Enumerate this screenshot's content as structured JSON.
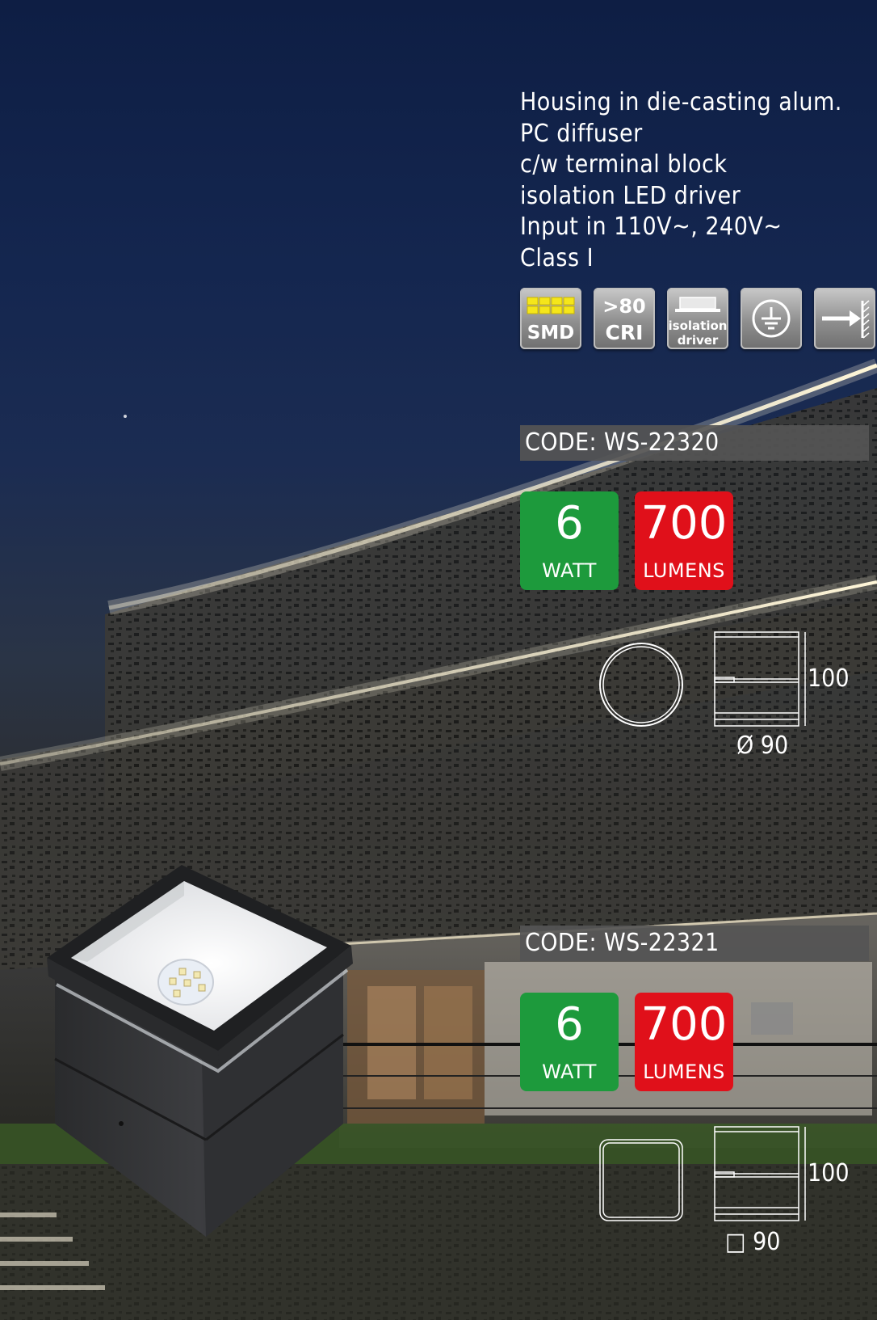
{
  "specs": {
    "lines": [
      "Housing in die-casting alum.",
      "PC diffuser",
      "c/w terminal block",
      "isolation LED driver",
      "Input in 110V~, 240V~",
      "Class I"
    ]
  },
  "badges": {
    "smd": "SMD",
    "cri_value": ">80",
    "cri_label": "CRI",
    "isolation_line1": "isolation",
    "isolation_line2": "driver",
    "class_icon": "earth-ground-icon",
    "distance_icon": "arrow-to-wall-icon"
  },
  "products": [
    {
      "code": "CODE: WS-22320",
      "watt_value": "6",
      "watt_label": "WATT",
      "lumen_value": "700",
      "lumen_label": "LUMENS",
      "height": "100",
      "width": "Ø 90",
      "shape": "round"
    },
    {
      "code": "CODE: WS-22321",
      "watt_value": "6",
      "watt_label": "WATT",
      "lumen_value": "700",
      "lumen_label": "LUMENS",
      "height": "100",
      "width": "□ 90",
      "shape": "square"
    }
  ],
  "colors": {
    "watt_green": "#1d9a3c",
    "lumen_red": "#e0101a",
    "code_bar": "#555555",
    "smd_yellow": "#f5e61a"
  }
}
